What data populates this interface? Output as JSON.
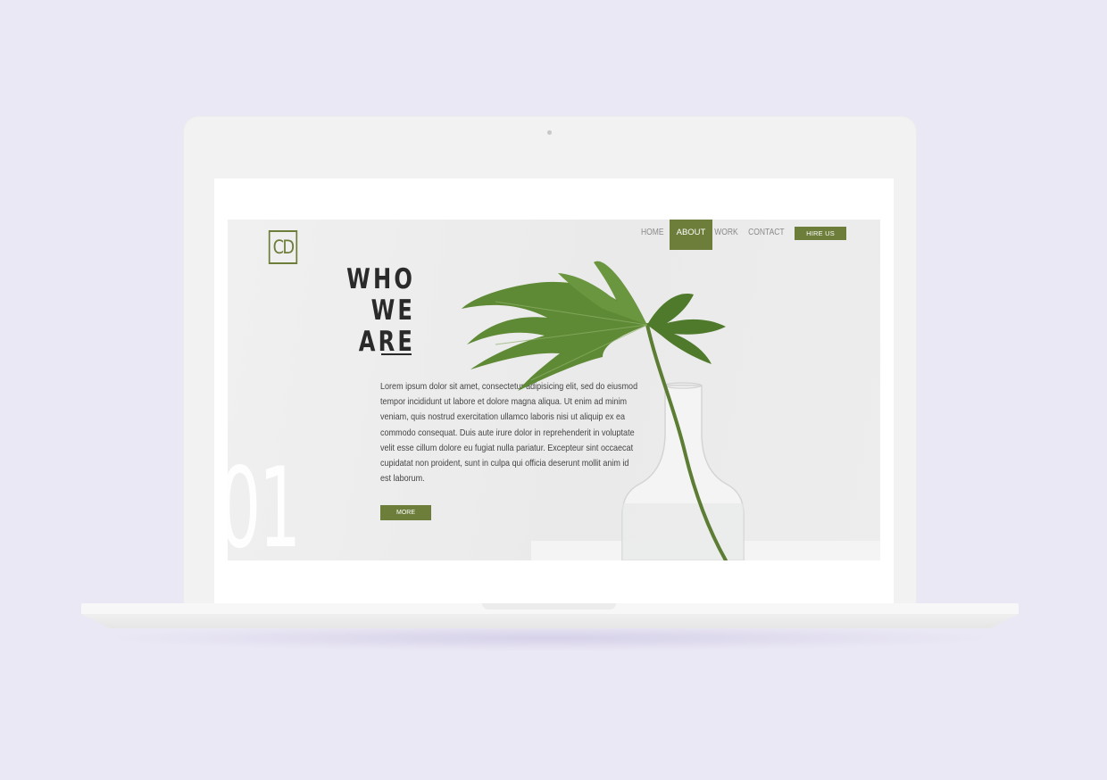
{
  "site": {
    "logo": "CD",
    "nav": [
      {
        "label": "HOME",
        "active": false
      },
      {
        "label": "ABOUT",
        "active": true
      },
      {
        "label": "WORK",
        "active": false
      },
      {
        "label": "CONTACT",
        "active": false
      }
    ],
    "hire_button": "HIRE US",
    "title_line1": "WHO",
    "title_line2": "WE ARE",
    "body": "Lorem ipsum dolor sit amet, consectetur adipisicing elit, sed do eiusmod tempor incididunt ut labore et dolore magna aliqua. Ut enim ad minim veniam, quis nostrud exercitation ullamco laboris nisi ut aliquip ex ea commodo consequat. Duis aute irure dolor in reprehenderit in voluptate velit esse cillum dolore eu fugiat nulla pariatur. Excepteur sint occaecat cupidatat non proident, sunt in culpa qui officia deserunt mollit anim id est laborum.",
    "more_button": "MORE",
    "section_number": "01"
  },
  "colors": {
    "background": "#ebe8f5",
    "accent": "#6d7d3a",
    "text": "#2a2a2a"
  }
}
